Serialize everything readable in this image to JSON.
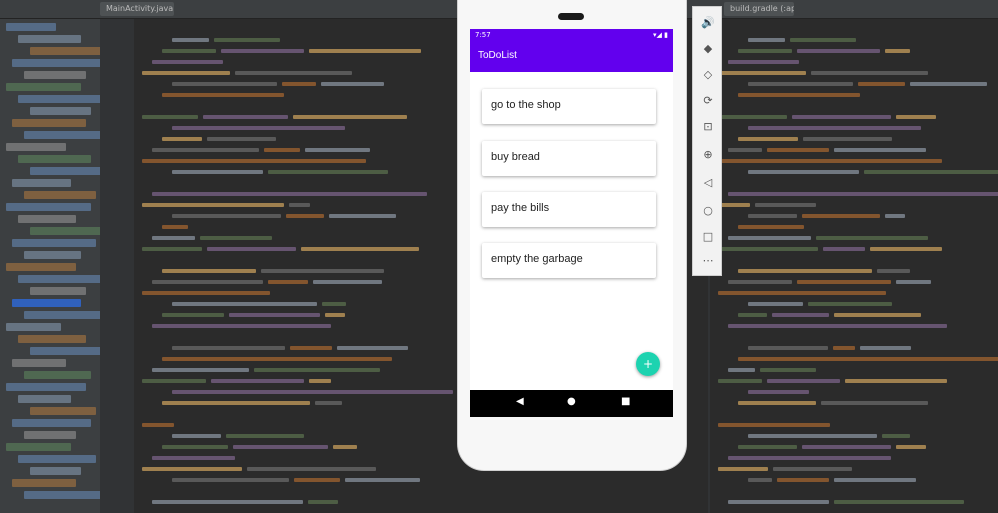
{
  "ide": {
    "tab_left": "MainActivity.java",
    "tab_right": "build.gradle (:app)"
  },
  "phone": {
    "status_time": "7:57",
    "status_icons": "▾◢ ▮",
    "app_title": "ToDoList",
    "items": [
      {
        "label": "go to the shop"
      },
      {
        "label": "buy bread"
      },
      {
        "label": "pay the bills"
      },
      {
        "label": "empty the garbage"
      }
    ],
    "fab_icon": "+",
    "nav": {
      "back": "◀",
      "home": "●",
      "recents": "■"
    }
  },
  "emulator_toolbar": {
    "tools": [
      {
        "name": "volume-up-icon",
        "glyph": "🔊"
      },
      {
        "name": "volume-down-icon",
        "glyph": "◆"
      },
      {
        "name": "rotate-left-icon",
        "glyph": "◇"
      },
      {
        "name": "rotate-right-icon",
        "glyph": "⟳"
      },
      {
        "name": "camera-icon",
        "glyph": "⊡"
      },
      {
        "name": "zoom-icon",
        "glyph": "⊕"
      },
      {
        "name": "back-icon",
        "glyph": "◁"
      },
      {
        "name": "home-icon",
        "glyph": "○"
      },
      {
        "name": "overview-icon",
        "glyph": "□"
      },
      {
        "name": "more-icon",
        "glyph": "⋯"
      }
    ]
  },
  "colors": {
    "app_bar": "#6200ee",
    "fab": "#1dd3b0",
    "ide_bg": "#2b2b2b"
  }
}
